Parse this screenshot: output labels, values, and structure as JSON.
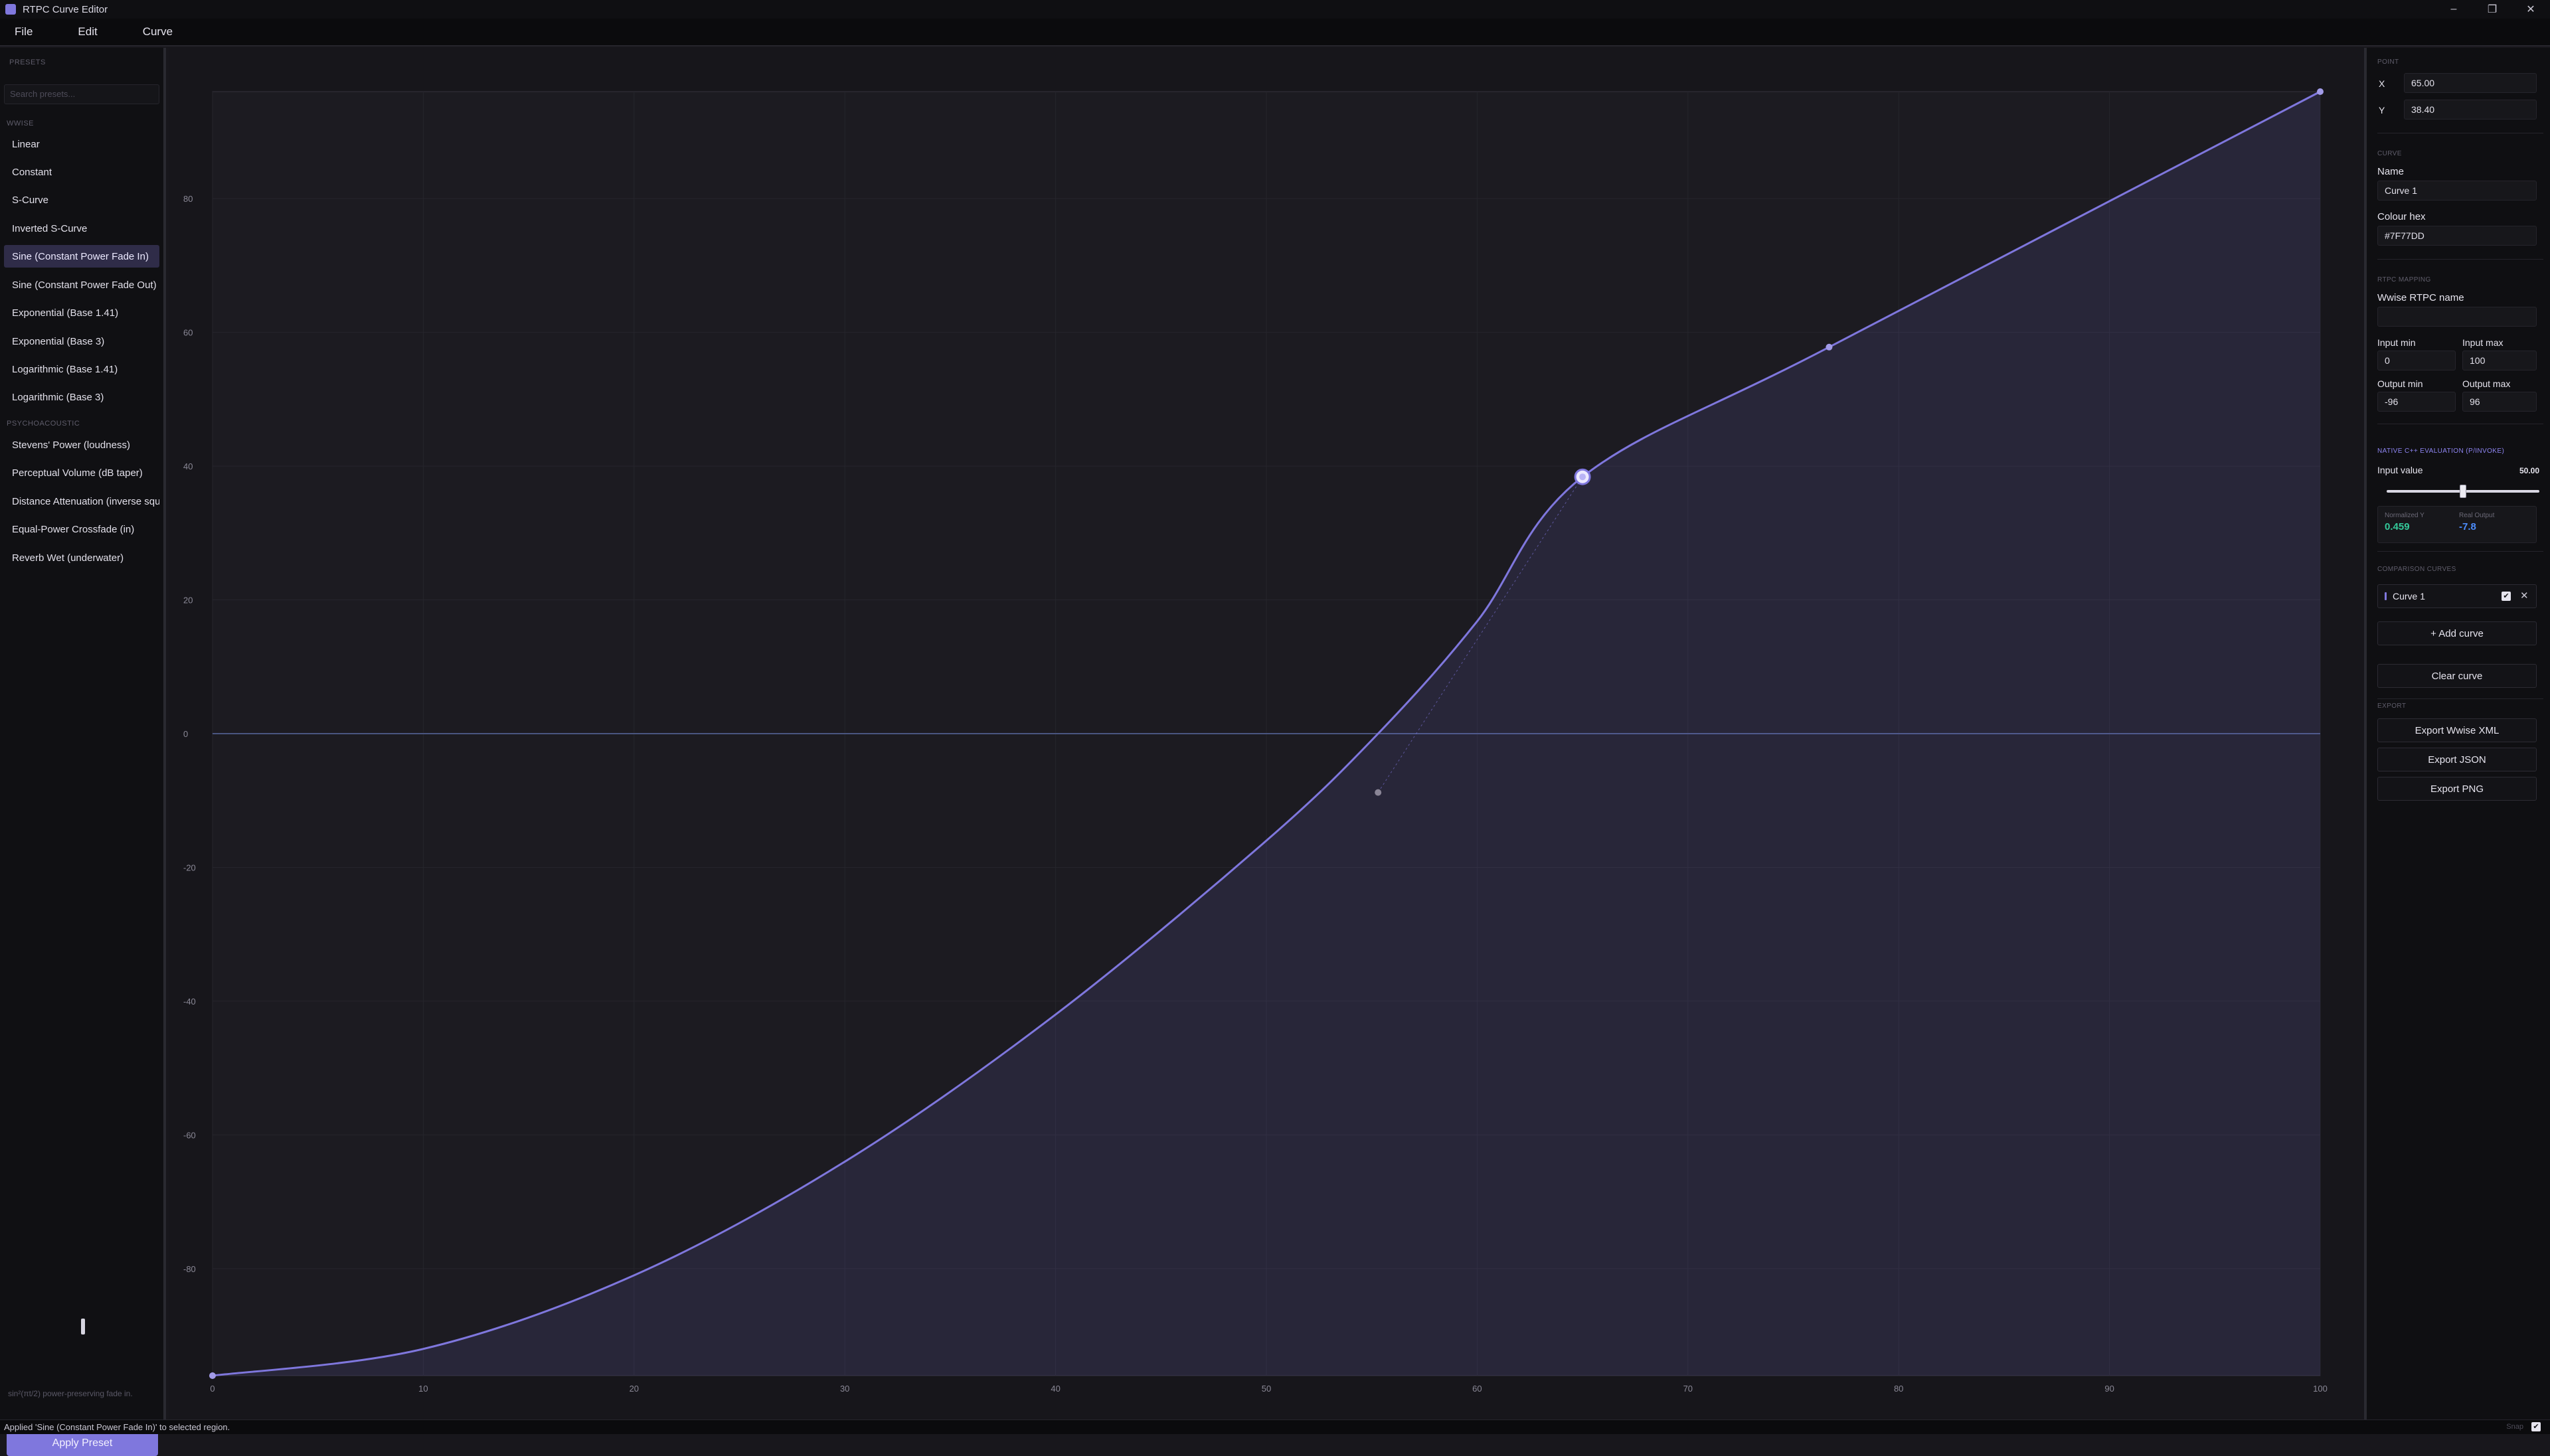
{
  "window": {
    "title": "RTPC Curve Editor",
    "minimize": "–",
    "restore": "❐",
    "close": "✕"
  },
  "menu": [
    "File",
    "Edit",
    "Curve"
  ],
  "sidebar": {
    "section_title": "PRESETS",
    "search_placeholder": "Search presets...",
    "group_1": "Wwise",
    "group_2": "Psychoacoustic",
    "presets": [
      "Linear",
      "Constant",
      "S-Curve",
      "Inverted S-Curve",
      "Sine (Constant Power Fade In)",
      "Sine (Constant Power Fade Out)",
      "Exponential (Base 1.41)",
      "Exponential (Base 3)",
      "Logarithmic (Base 1.41)",
      "Logarithmic (Base 3)"
    ],
    "presets_psycho": [
      "Stevens' Power (loudness)",
      "Perceptual Volume (dB taper)",
      "Distance Attenuation (inverse squ",
      "Equal-Power Crossfade (in)",
      "Reverb Wet (underwater)"
    ],
    "active_preset": "Sine (Constant Power Fade In)",
    "description": "sin²(πt/2) power-preserving fade in.",
    "apply_label": "Apply Preset"
  },
  "chart_data": {
    "type": "line",
    "x_ticks": [
      "0",
      "10",
      "20",
      "30",
      "40",
      "50",
      "60",
      "70",
      "80",
      "90",
      "100"
    ],
    "y_ticks": [
      "80",
      "60",
      "40",
      "20",
      "0",
      "-20",
      "-40",
      "-60",
      "-80"
    ],
    "xlim": [
      0,
      100
    ],
    "ylim": [
      -96,
      96
    ],
    "grid": true,
    "series": [
      {
        "points": [
          [
            0,
            -96
          ],
          [
            10,
            -92
          ],
          [
            20,
            -81
          ],
          [
            30,
            -64
          ],
          [
            40,
            -42
          ],
          [
            50,
            -16
          ],
          [
            55.3,
            0
          ],
          [
            60,
            16.8
          ],
          [
            65,
            38.4
          ],
          [
            76.7,
            57.8
          ],
          [
            100,
            96
          ]
        ],
        "color": "#7F77DD"
      }
    ],
    "control_points": [
      [
        0,
        -96
      ],
      [
        65,
        38.4
      ],
      [
        76.7,
        57.8
      ],
      [
        100,
        96
      ]
    ],
    "handle_points": [
      [
        55.3,
        -8.8
      ]
    ],
    "selected_point": [
      65,
      38.4
    ]
  },
  "panel": {
    "point_head": "POINT",
    "x_label": "X",
    "x_value": "65.00",
    "y_label": "Y",
    "y_value": "38.40",
    "curve_head": "CURVE",
    "name_label": "Name",
    "name_value": "Curve 1",
    "colour_label": "Colour hex",
    "colour_value": "#7F77DD",
    "rtpc_head": "RTPC MAPPING",
    "wwise_name_label": "Wwise RTPC name",
    "wwise_name_value": "",
    "input_min_label": "Input min",
    "input_min_value": "0",
    "input_max_label": "Input max",
    "input_max_value": "100",
    "output_min_label": "Output min",
    "output_min_value": "-96",
    "output_max_label": "Output max",
    "output_max_value": "96",
    "native_head": "NATIVE C++ EVALUATION (P/INVOKE)",
    "input_value_label": "Input value",
    "input_value": "50.00",
    "input_value_fraction": 0.5,
    "norm_label": "Normalized Y",
    "norm_value": "0.459",
    "real_label": "Real Output",
    "real_value": "-7.8",
    "compare_head": "COMPARISON CURVES",
    "compare_curve": "Curve 1",
    "add_curve": "+ Add curve",
    "clear_curve": "Clear curve",
    "export_head": "EXPORT",
    "export_xml": "Export Wwise XML",
    "export_json": "Export JSON",
    "export_png": "Export PNG"
  },
  "status": {
    "message": "Applied 'Sine (Constant Power Fade In)' to selected region.",
    "snap_label": "Snap"
  },
  "colors": {
    "accent": "#7F77DD",
    "positive": "#34C99A",
    "negative": "#4C8DFF"
  }
}
